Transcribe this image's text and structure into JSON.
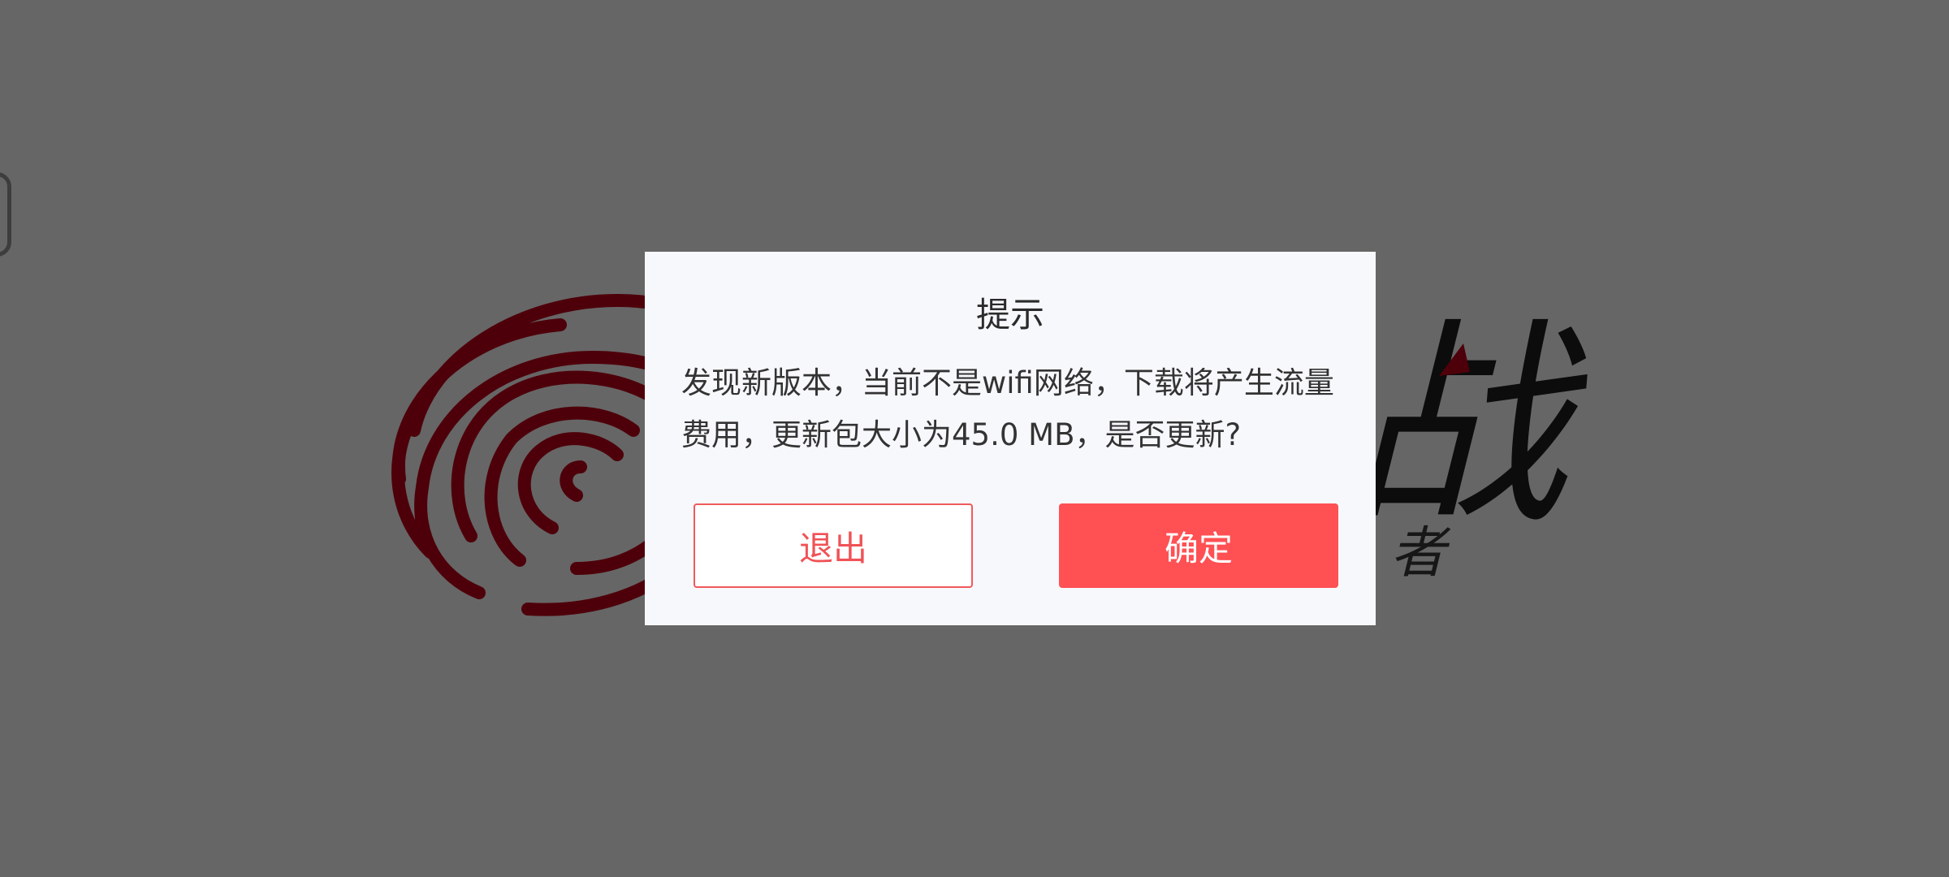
{
  "splash": {
    "brand_char": "战",
    "brand_subtitle": "者",
    "logo_icon": "fingerprint-logo-icon",
    "colors": {
      "logo_red": "#c4001a",
      "brand_text": "#1e1e1e"
    }
  },
  "dialog": {
    "title": "提示",
    "message": "发现新版本，当前不是wifi网络，下载将产生流量费用，更新包大小为45.0 MB，是否更新?",
    "exit_label": "退出",
    "confirm_label": "确定",
    "colors": {
      "accent": "#ff5054",
      "background": "#f7f8fc",
      "overlay": "rgba(0,0,0,0.6)"
    }
  }
}
